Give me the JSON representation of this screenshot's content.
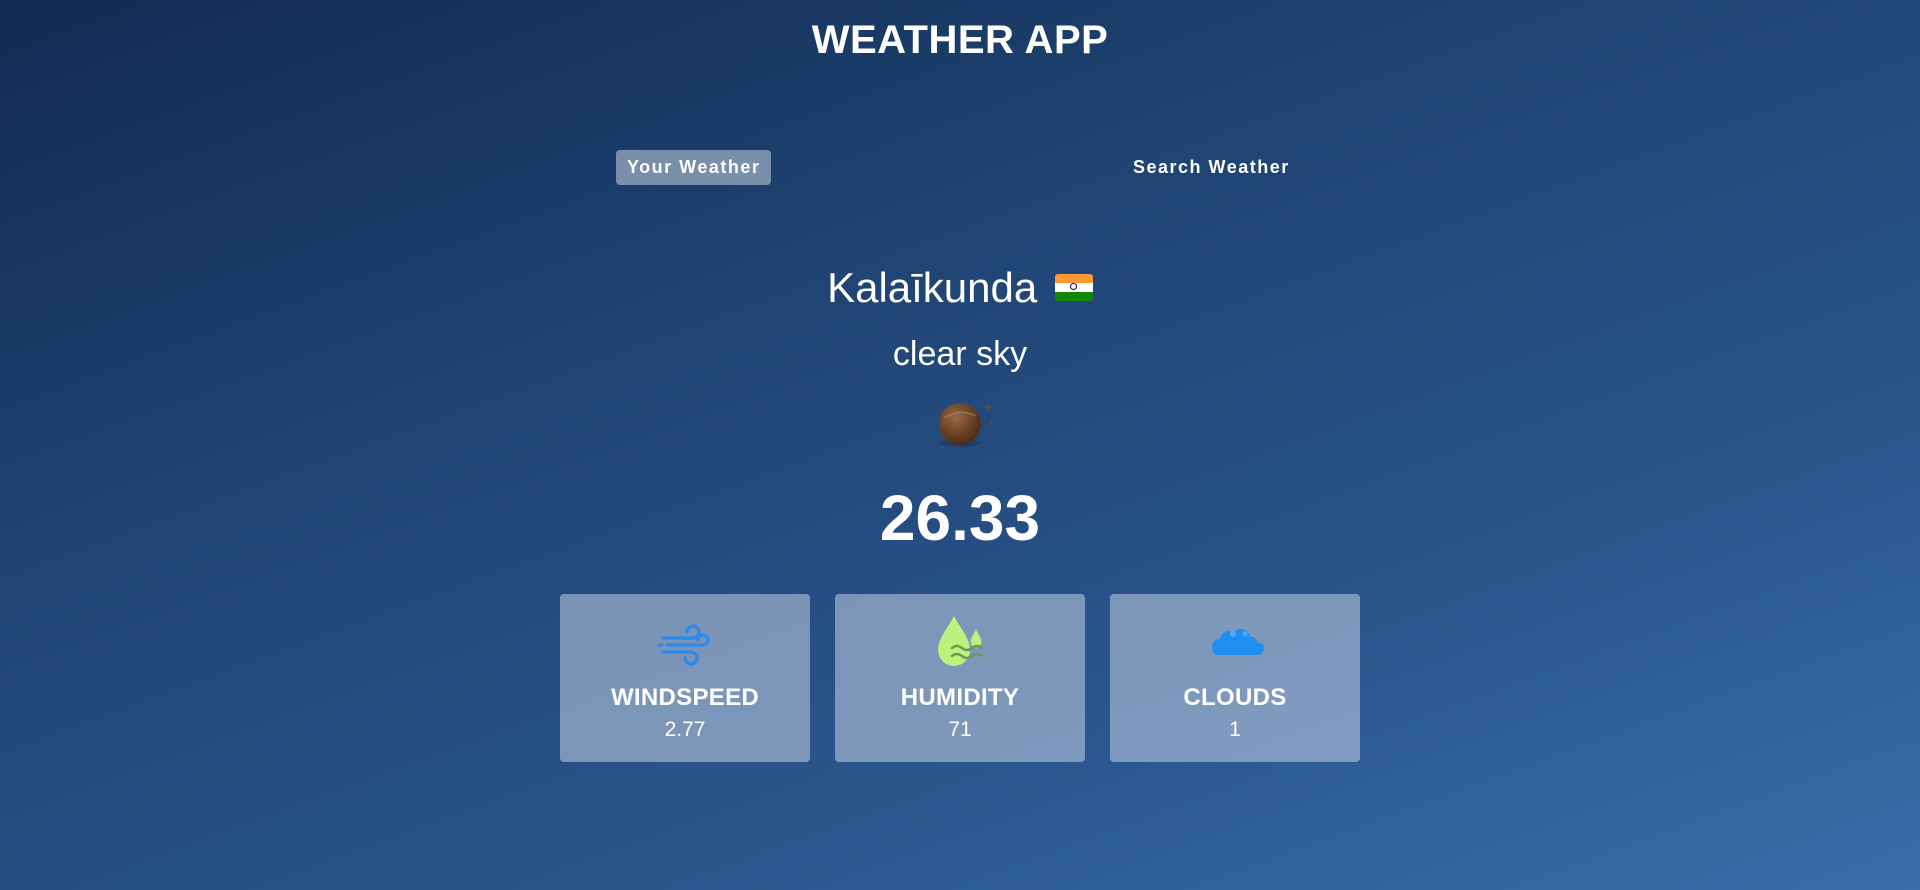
{
  "app": {
    "title": "WEATHER APP"
  },
  "tabs": [
    {
      "label": "Your Weather",
      "active": true
    },
    {
      "label": "Search Weather",
      "active": false
    }
  ],
  "weather": {
    "city": "Kalaīkunda",
    "country_flag_icon": "india-flag-icon",
    "description": "clear sky",
    "condition_icon": "clear-sky-night-icon",
    "temperature": "26.33"
  },
  "stats": [
    {
      "label": "WINDSPEED",
      "value": "2.77",
      "icon": "wind-icon"
    },
    {
      "label": "HUMIDITY",
      "value": "71",
      "icon": "humidity-icon"
    },
    {
      "label": "CLOUDS",
      "value": "1",
      "icon": "cloud-icon"
    }
  ],
  "colors": {
    "background_top": "#112b52",
    "background_bottom": "#3a6daa",
    "active_tab": "#a7b5cc",
    "card_bg": "#8a9dbd",
    "wind_icon": "#2f8be6",
    "humidity_icon": "#b9f27c",
    "cloud_icon": "#1e8ff0"
  }
}
